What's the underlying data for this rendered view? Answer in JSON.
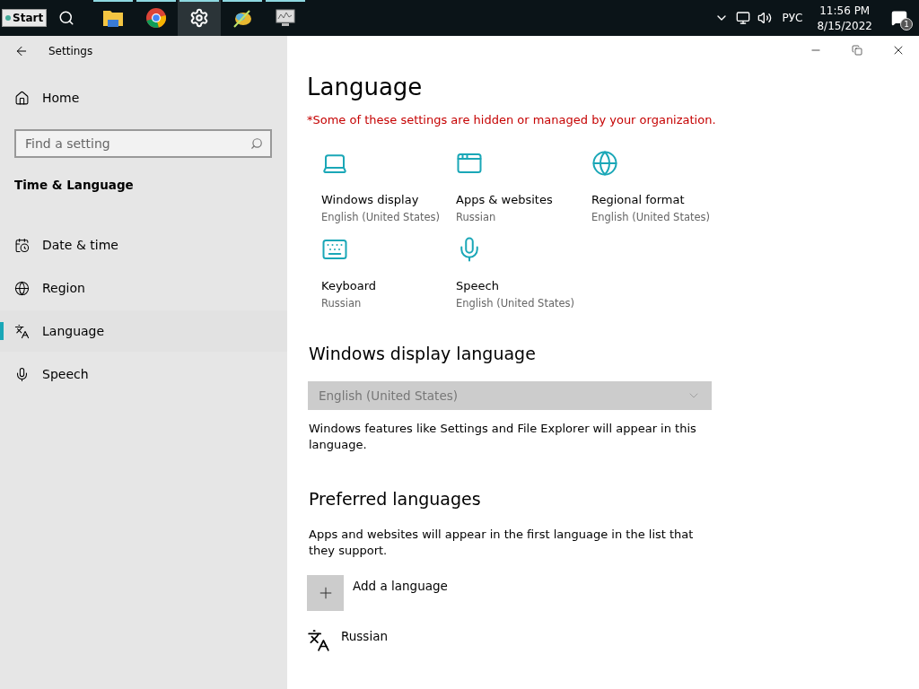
{
  "taskbar": {
    "start_label": "Start",
    "apps": [
      {
        "kind": "explorer",
        "running": true,
        "active": false
      },
      {
        "kind": "chrome",
        "running": true,
        "active": false
      },
      {
        "kind": "settings",
        "running": true,
        "active": true
      },
      {
        "kind": "tool",
        "running": true,
        "active": false
      },
      {
        "kind": "monitor",
        "running": true,
        "active": false
      }
    ],
    "tray": {
      "language": "РУС",
      "time": "11:56 PM",
      "date": "8/15/2022",
      "notification_count": "1"
    }
  },
  "window": {
    "title": "Settings"
  },
  "sidebar": {
    "home": "Home",
    "search": {
      "placeholder": "Find a setting"
    },
    "section": "Time & Language",
    "items": [
      {
        "kind": "calendar",
        "label": "Date & time",
        "selected": false
      },
      {
        "kind": "globe",
        "label": "Region",
        "selected": false
      },
      {
        "kind": "language",
        "label": "Language",
        "selected": true
      },
      {
        "kind": "microphone",
        "label": "Speech",
        "selected": false
      }
    ]
  },
  "main": {
    "title": "Language",
    "notice": "*Some of these settings are hidden or managed by your organization.",
    "tiles": [
      {
        "kind": "laptop",
        "title": "Windows display",
        "value": "English (United States)"
      },
      {
        "kind": "window",
        "title": "Apps & websites",
        "value": "Russian"
      },
      {
        "kind": "globe",
        "title": "Regional format",
        "value": "English (United States)"
      },
      {
        "kind": "keyboard",
        "title": "Keyboard",
        "value": "Russian"
      },
      {
        "kind": "microphone",
        "title": "Speech",
        "value": "English (United States)"
      }
    ],
    "display_language": {
      "heading": "Windows display language",
      "value": "English (United States)",
      "disabled": true,
      "description": "Windows features like Settings and File Explorer will appear in this language."
    },
    "preferred": {
      "heading": "Preferred languages",
      "description": "Apps and websites will appear in the first language in the list that they support.",
      "add_label": "Add a language",
      "languages": [
        {
          "name": "Russian"
        }
      ]
    }
  }
}
